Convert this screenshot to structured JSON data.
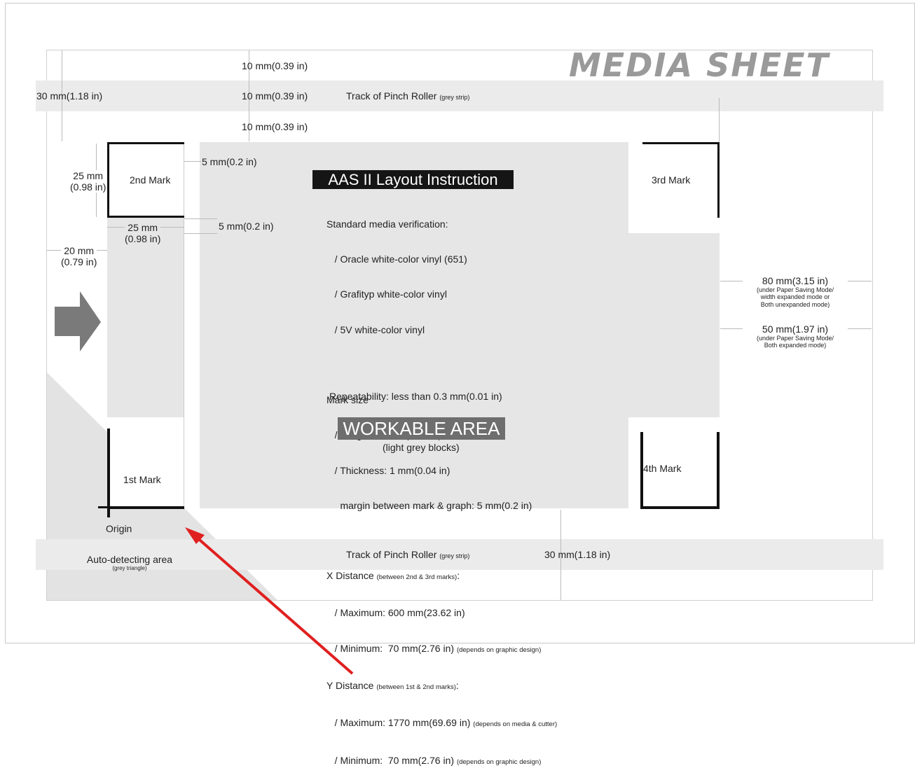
{
  "title": "MEDIA SHEET",
  "top_dims": {
    "d1": "10 mm(0.39 in)",
    "d2": "10 mm(0.39 in)",
    "d3": "10 mm(0.39 in)",
    "d_left": "30 mm(1.18 in)"
  },
  "pinch_roller": {
    "label": "Track of Pinch Roller",
    "note": "(grey strip)"
  },
  "marks": {
    "mark2": "2nd Mark",
    "mark3": "3rd Mark",
    "mark1": "1st Mark",
    "mark4": "4th Mark",
    "origin": "Origin"
  },
  "left_dims": {
    "mark_h_mm": "25 mm",
    "mark_h_in": "(0.98 in)",
    "gap_top": "5 mm(0.2 in)",
    "gap_side": "5 mm(0.2 in)",
    "mark_w_mm": "25 mm",
    "mark_w_in": "(0.98 in)",
    "left_mm": "20 mm",
    "left_in": "(0.79 in)"
  },
  "instructions": {
    "heading": "AAS II Layout Instruction",
    "l1": "Standard media verification:",
    "l2": "   / Oracle white-color vinyl (651)",
    "l3": "   / Grafityp white-color vinyl",
    "l4": "   / 5V white-color vinyl",
    "l5": "Mark size",
    "l6": "   / Length: 25 mm(0.98 in)",
    "l7": "   / Thickness: 1 mm(0.04 in)",
    "l8": "     margin between mark & graph: 5 mm(0.2 in)",
    "l9a": "X Distance ",
    "l9b": "(between 2nd & 3rd marks)",
    "l9c": ":",
    "l10": "   / Maximum: 600 mm(23.62 in)",
    "l11a": "   / Minimum:  70 mm(2.76 in) ",
    "l11b": "(depends on graphic design)",
    "l12a": "Y Distance ",
    "l12b": "(between 1st & 2nd marks)",
    "l12c": ":",
    "l13a": "   / Maximum: 1770 mm(69.69 in) ",
    "l13b": "(depends on media & cutter)",
    "l14a": "   / Minimum:  70 mm(2.76 in) ",
    "l14b": "(depends on graphic design)",
    "repeat": "Repeatability: less than 0.3 mm(0.01 in)"
  },
  "workable": {
    "label": "WORKABLE AREA",
    "sub": "(light grey blocks)"
  },
  "right_dims": {
    "r80": "80 mm(3.15 in)",
    "r80_n1": "(under Paper Saving Mode/",
    "r80_n2": "width expanded mode or",
    "r80_n3": "Both unexpanded mode)",
    "r50": "50 mm(1.97 in)",
    "r50_n1": "(under Paper Saving Mode/",
    "r50_n2": "Both expanded mode)"
  },
  "bottom": {
    "d30": "30 mm(1.18 in)",
    "auto": "Auto-detecting area",
    "auto_note": "(grey triangle)"
  },
  "colors": {
    "arrow_annotation": "#e02020",
    "workable_grey": "#e6e6e6",
    "strip_grey": "#ebebeb",
    "title_grey": "#9a9a9a"
  }
}
